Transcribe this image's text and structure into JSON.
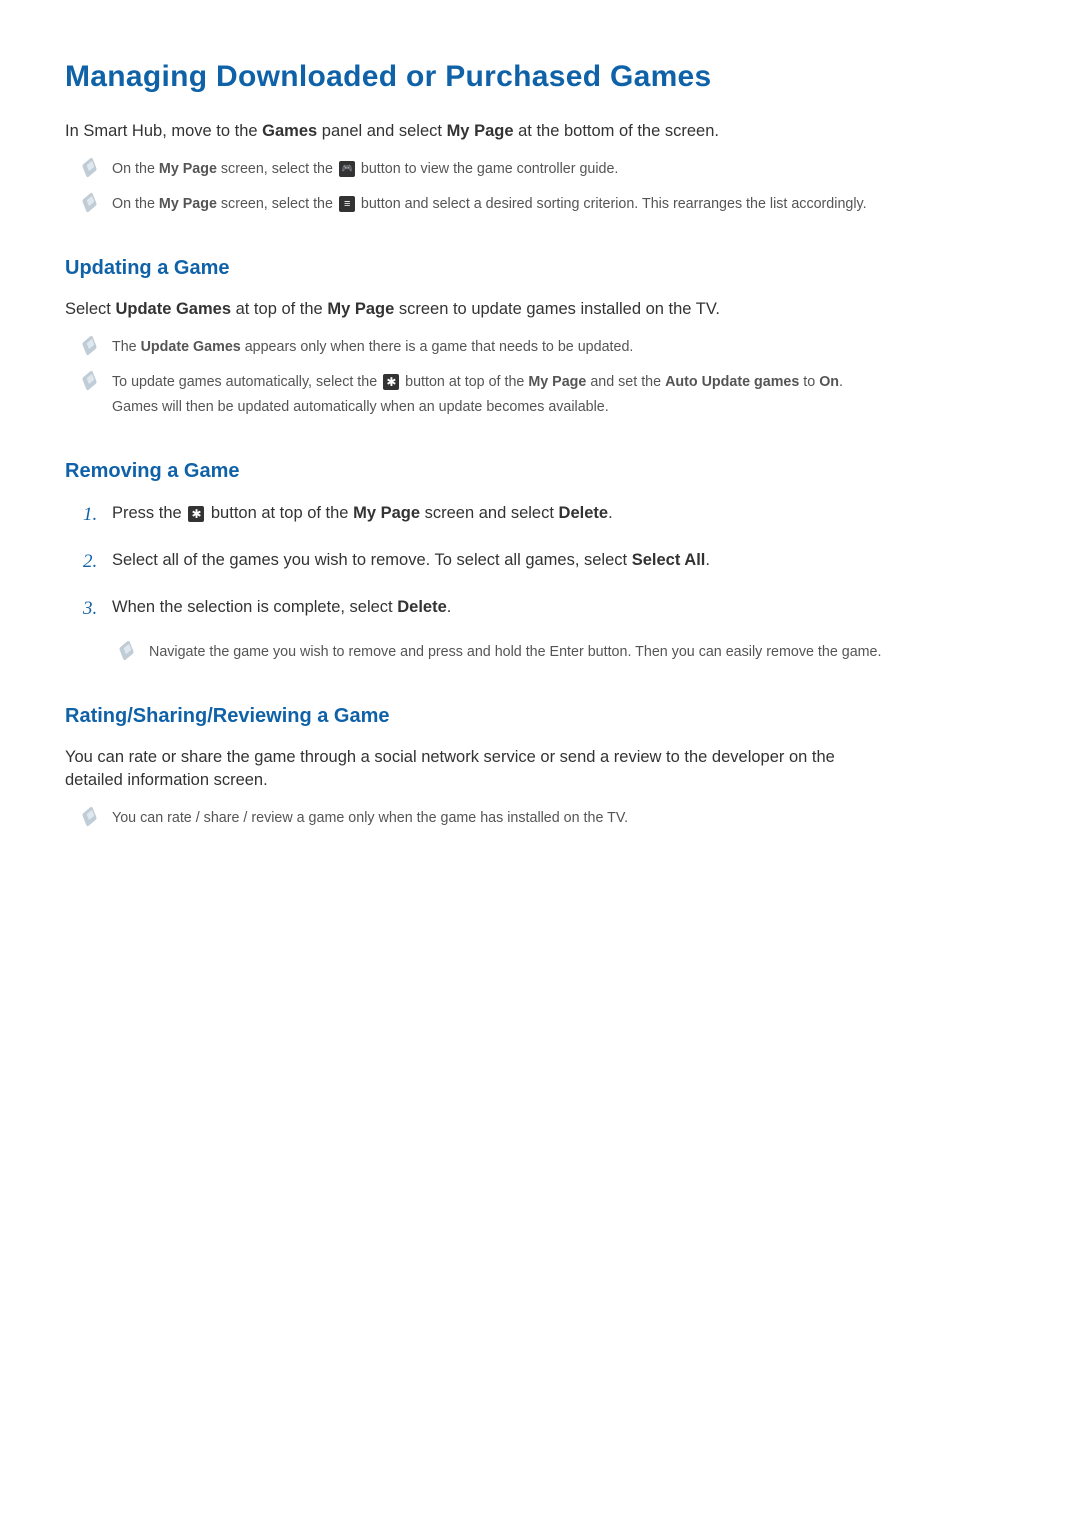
{
  "title": "Managing Downloaded or Purchased Games",
  "intro": {
    "pre": "In Smart Hub, move to the ",
    "bold1": "Games",
    "mid": " panel and select ",
    "bold2": "My Page",
    "post": " at the bottom of the screen."
  },
  "intro_notes": [
    {
      "pre": "On the ",
      "b1": "My Page",
      "mid": " screen, select the ",
      "icon": "controller",
      "post": " button to view the game controller guide."
    },
    {
      "pre": "On the ",
      "b1": "My Page",
      "mid": " screen, select the ",
      "icon": "list",
      "post": " button and select a desired sorting criterion. This rearranges the list accordingly."
    }
  ],
  "updating": {
    "title": "Updating a Game",
    "lead": {
      "pre": "Select ",
      "b1": "Update Games",
      "mid": " at top of the ",
      "b2": "My Page",
      "post": " screen to update games installed on the TV."
    },
    "notes": [
      {
        "pre": "The ",
        "b1": "Update Games",
        "post": " appears only when there is a game that needs to be updated."
      },
      {
        "pre": "To update games automatically, select the ",
        "icon": "gear",
        "mid": " button at top of the ",
        "b1": "My Page",
        "mid2": " and set the ",
        "b2": "Auto Update games",
        "mid3": " to ",
        "b3": "On",
        "post": ". Games will then be updated automatically when an update becomes available."
      }
    ]
  },
  "removing": {
    "title": "Removing a Game",
    "steps": [
      {
        "pre": "Press the ",
        "icon": "gear",
        "mid": " button at top of the ",
        "b1": "My Page",
        "mid2": " screen and select ",
        "b2": "Delete",
        "post": "."
      },
      {
        "pre": "Select all of the games you wish to remove. To select all games, select ",
        "b1": "Select All",
        "post": "."
      },
      {
        "pre": "When the selection is complete, select ",
        "b1": "Delete",
        "post": ".",
        "subnote": "Navigate the game you wish to remove and press and hold the Enter button. Then you can easily remove the game."
      }
    ]
  },
  "rating": {
    "title": "Rating/Sharing/Reviewing a Game",
    "lead": "You can rate or share the game through a social network service or send a review to the developer on the detailed information screen.",
    "note": "You can rate / share / review a game only when the game has installed on the TV."
  }
}
